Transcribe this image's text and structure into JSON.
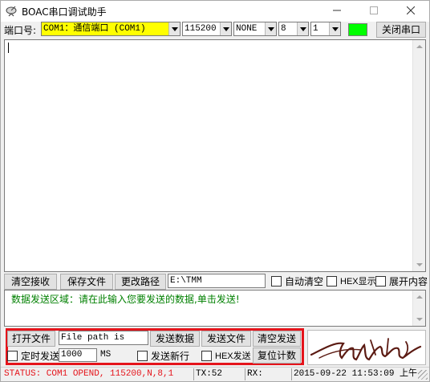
{
  "window": {
    "title": "BOAC串口调试助手",
    "icons": {
      "app": "satellite-dish-icon",
      "minimize": "minimize-icon",
      "maximize": "maximize-icon",
      "close": "close-icon"
    }
  },
  "toolbar": {
    "port_label": "端口号:",
    "port_value": "COM1：通信端口 (COM1)",
    "baud_value": "115200",
    "parity_value": "NONE",
    "databits_value": "8",
    "stopbits_value": "1",
    "indicator_color": "#00ff00",
    "close_port_label": "关闭串口"
  },
  "receive": {
    "clear_label": "清空接收",
    "save_label": "保存文件",
    "change_path_label": "更改路径",
    "path_value": "E:\\TMM",
    "auto_clear_label": "自动清空",
    "hex_display_label": "HEX显示",
    "expand_label": "展开内容"
  },
  "send": {
    "hint": "数据发送区域：请在此输入您要发送的数据,单击发送!",
    "hint_color": "#008000",
    "open_file_label": "打开文件",
    "file_path_value": "File path is",
    "send_data_label": "发送数据",
    "send_file_label": "发送文件",
    "clear_send_label": "清空发送",
    "timed_send_label": "定时发送",
    "interval_value": "1000",
    "interval_unit": "MS",
    "send_newline_label": "发送新行",
    "hex_send_label": "HEX发送",
    "reset_count_label": "复位计数",
    "panel_highlight_color": "#e5141b"
  },
  "statusbar": {
    "status": "STATUS: COM1 OPEND, 115200,N,8,1",
    "tx": "TX:52",
    "rx": "RX:",
    "time": "2015-09-22  11:53:09 上午"
  }
}
